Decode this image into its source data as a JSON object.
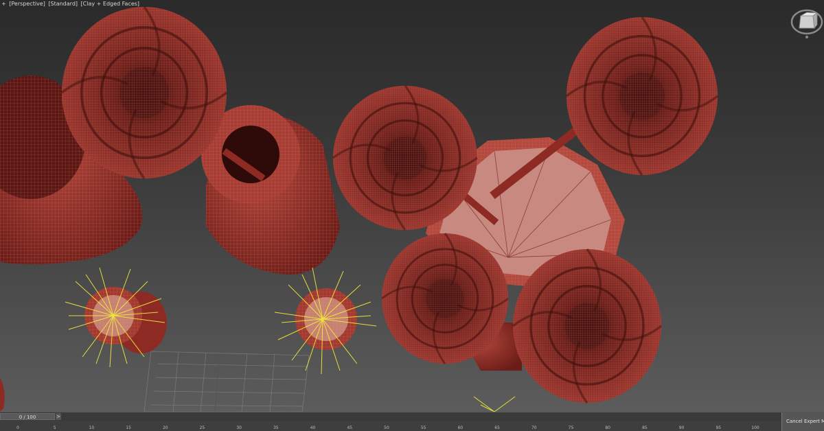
{
  "viewport": {
    "labels": [
      "+",
      "[Perspective]",
      "[Standard]",
      "[Clay + Edged Faces]"
    ]
  },
  "timeline": {
    "frame_display": "0 / 100",
    "next_arrow": ">",
    "ruler_ticks": [
      "0",
      "5",
      "10",
      "15",
      "20",
      "25",
      "30",
      "35",
      "40",
      "45",
      "50",
      "55",
      "60",
      "65",
      "70",
      "75",
      "80",
      "85",
      "90",
      "95",
      "100"
    ],
    "cancel_label": "Cancel Expert Mode"
  },
  "colors": {
    "clay": "#8e2a24",
    "wire": "#d37a70",
    "light": "#f2ee3a",
    "grid": "#8a8a8a"
  }
}
